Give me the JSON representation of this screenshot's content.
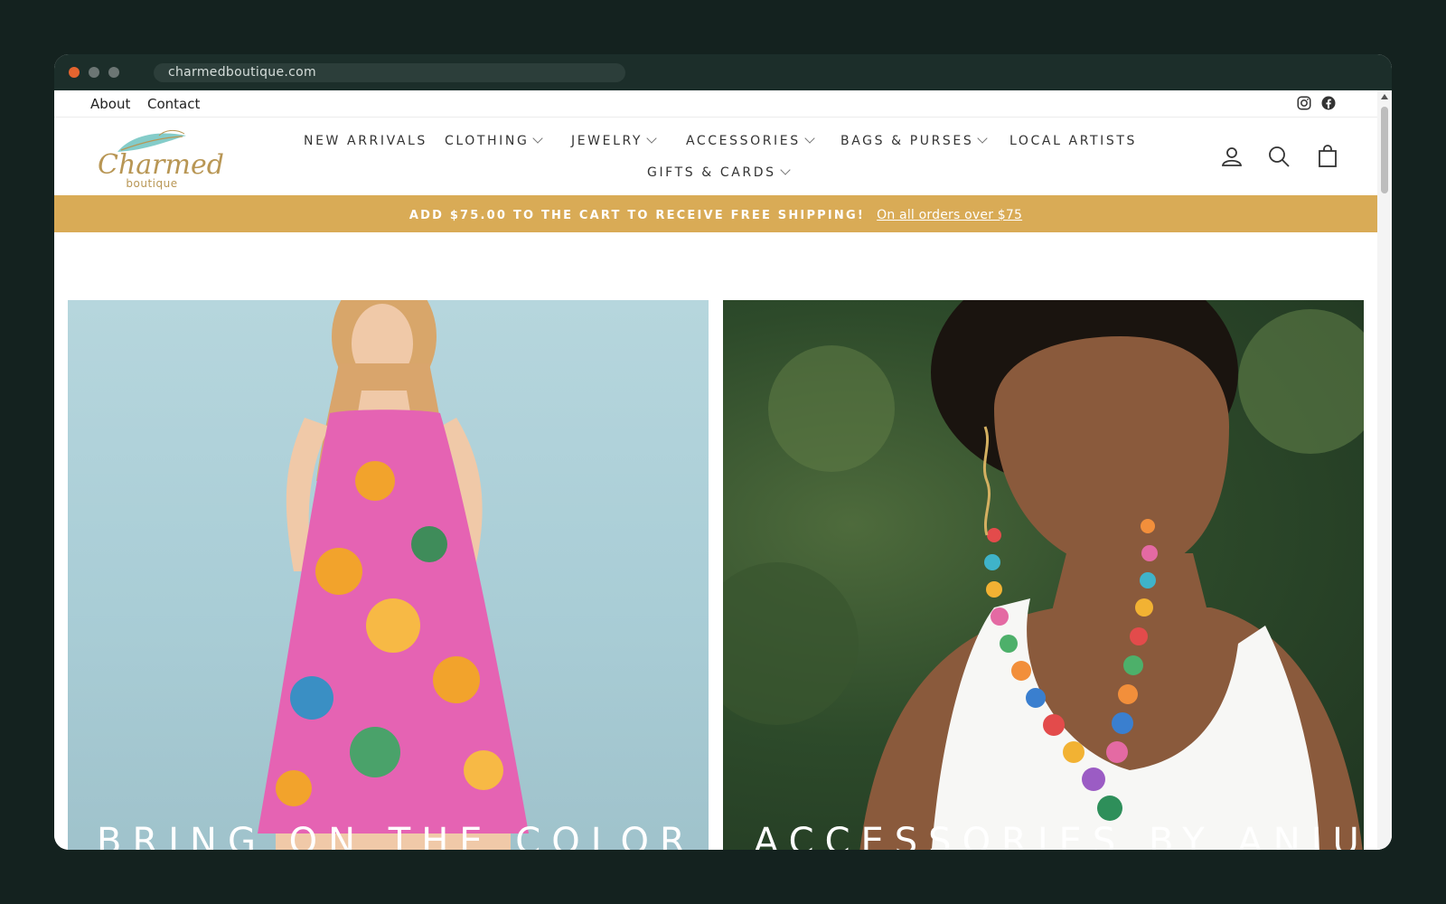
{
  "browser": {
    "url": "charmedboutique.com"
  },
  "topbar": {
    "about": "About",
    "contact": "Contact",
    "social_icons": [
      "instagram-icon",
      "facebook-icon"
    ]
  },
  "logo": {
    "script": "Charmed",
    "sub": "boutique"
  },
  "nav": {
    "items": [
      {
        "label": "NEW ARRIVALS",
        "dropdown": false
      },
      {
        "label": "CLOTHING",
        "dropdown": true
      },
      {
        "label": "JEWELRY",
        "dropdown": true
      },
      {
        "label": "ACCESSORIES",
        "dropdown": true
      },
      {
        "label": "BAGS & PURSES",
        "dropdown": true
      },
      {
        "label": "LOCAL ARTISTS",
        "dropdown": false
      },
      {
        "label": "GIFTS & CARDS",
        "dropdown": true
      }
    ]
  },
  "header_icons": [
    "account-icon",
    "search-icon",
    "cart-icon"
  ],
  "promo": {
    "text": "ADD $75.00 TO THE CART TO RECEIVE FREE SHIPPING!",
    "link": "On all orders over $75"
  },
  "tiles": [
    {
      "caption": "BRING ON THE COLOR"
    },
    {
      "caption": "ACCESSORIES BY ANJU"
    }
  ],
  "colors": {
    "window_bg": "#14221f",
    "chrome": "#1c2e2a",
    "promo_bar": "#d9ab56",
    "logo_gold": "#b89654",
    "close_dot": "#e4642f"
  }
}
